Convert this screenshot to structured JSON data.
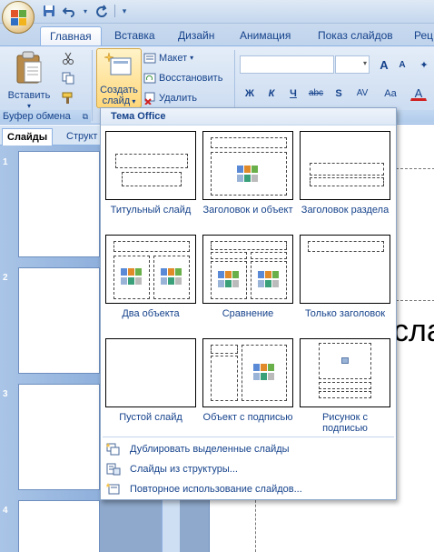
{
  "ribbon_tabs": [
    "Главная",
    "Вставка",
    "Дизайн",
    "Анимация",
    "Показ слайдов",
    "Рец"
  ],
  "clipboard": {
    "paste_label": "Вставить",
    "group_label": "Буфер обмена"
  },
  "slides_group": {
    "new_slide_line1": "Создать",
    "new_slide_line2": "слайд",
    "layout_label": "Макет",
    "reset_label": "Восстановить",
    "delete_label": "Удалить"
  },
  "font": {
    "bold": "Ж",
    "italic": "К",
    "underline": "Ч",
    "strike": "abc",
    "shadow": "S",
    "spacing": "AV",
    "case": "Aa",
    "grow": "A",
    "shrink": "A",
    "color": "A"
  },
  "pane": {
    "tab_slides": "Слайды",
    "tab_outline": "Структ",
    "slide_numbers": [
      "1",
      "2",
      "3",
      "4"
    ]
  },
  "slide_fragment": "сла",
  "gallery": {
    "header": "Тема Office",
    "layouts": [
      {
        "name": "Титульный слайд"
      },
      {
        "name": "Заголовок и объект"
      },
      {
        "name": "Заголовок раздела"
      },
      {
        "name": "Два объекта"
      },
      {
        "name": "Сравнение"
      },
      {
        "name": "Только заголовок"
      },
      {
        "name": "Пустой слайд"
      },
      {
        "name": "Объект с подписью"
      },
      {
        "name": "Рисунок с подписью"
      }
    ],
    "menu": [
      {
        "label": "Дублировать выделенные слайды"
      },
      {
        "label": "Слайды из структуры..."
      },
      {
        "label": "Повторное использование слайдов..."
      }
    ]
  },
  "colors": {
    "ribbon_text": "#15428b",
    "accent": "#f6c44c"
  }
}
